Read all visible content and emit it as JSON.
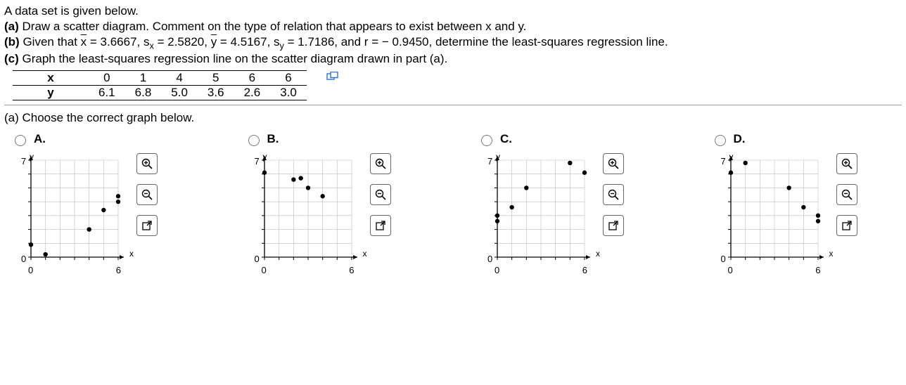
{
  "intro": "A data set is given below.",
  "parts": {
    "a": "Draw a scatter diagram. Comment on the type of relation that appears to exist between x and y.",
    "b_prefix": "Given that ",
    "b_xbar": "x",
    "b_xbar_val": " = 3.6667, s",
    "b_sx_val": " = 2.5820, ",
    "b_ybar": "y",
    "b_ybar_val": " = 4.5167, s",
    "b_sy_val": " = 1.7186, and r =  − 0.9450, determine the least-squares regression line.",
    "c": "Graph the least-squares regression line on the scatter diagram drawn in part (a)."
  },
  "table": {
    "row1_label": "x",
    "row2_label": "y",
    "x": [
      "0",
      "1",
      "4",
      "5",
      "6",
      "6"
    ],
    "y": [
      "6.1",
      "6.8",
      "5.0",
      "3.6",
      "2.6",
      "3.0"
    ]
  },
  "question_a": "(a) Choose the correct graph below.",
  "labels": {
    "a": "(a)",
    "b": "(b)",
    "c": "(c)"
  },
  "options": {
    "A": "A.",
    "B": "B.",
    "C": "C.",
    "D": "D."
  },
  "axes": {
    "ylabel": "y",
    "xlabel": "x",
    "ymin": "0",
    "ymax": "7",
    "xmin": "0",
    "xmax": "6"
  },
  "chart_data": [
    {
      "id": "A",
      "type": "scatter",
      "xlim": [
        0,
        6
      ],
      "ylim": [
        0,
        7
      ],
      "points": [
        [
          0,
          0.9
        ],
        [
          1,
          0.2
        ],
        [
          4,
          2.0
        ],
        [
          5,
          3.4
        ],
        [
          6,
          4.0
        ],
        [
          6,
          4.4
        ]
      ]
    },
    {
      "id": "B",
      "type": "scatter",
      "xlim": [
        0,
        6
      ],
      "ylim": [
        0,
        7
      ],
      "points": [
        [
          2,
          5.6
        ],
        [
          2.5,
          5.7
        ],
        [
          3,
          5.0
        ],
        [
          4,
          4.4
        ],
        [
          0,
          6.1
        ]
      ]
    },
    {
      "id": "C",
      "type": "scatter",
      "xlim": [
        0,
        6
      ],
      "ylim": [
        0,
        7
      ],
      "points": [
        [
          0,
          3.0
        ],
        [
          0,
          2.6
        ],
        [
          1,
          3.6
        ],
        [
          2,
          5.0
        ],
        [
          5,
          6.8
        ],
        [
          6,
          6.1
        ]
      ]
    },
    {
      "id": "D",
      "type": "scatter",
      "xlim": [
        0,
        6
      ],
      "ylim": [
        0,
        7
      ],
      "points": [
        [
          0,
          6.1
        ],
        [
          1,
          6.8
        ],
        [
          4,
          5.0
        ],
        [
          5,
          3.6
        ],
        [
          6,
          2.6
        ],
        [
          6,
          3.0
        ]
      ]
    }
  ]
}
